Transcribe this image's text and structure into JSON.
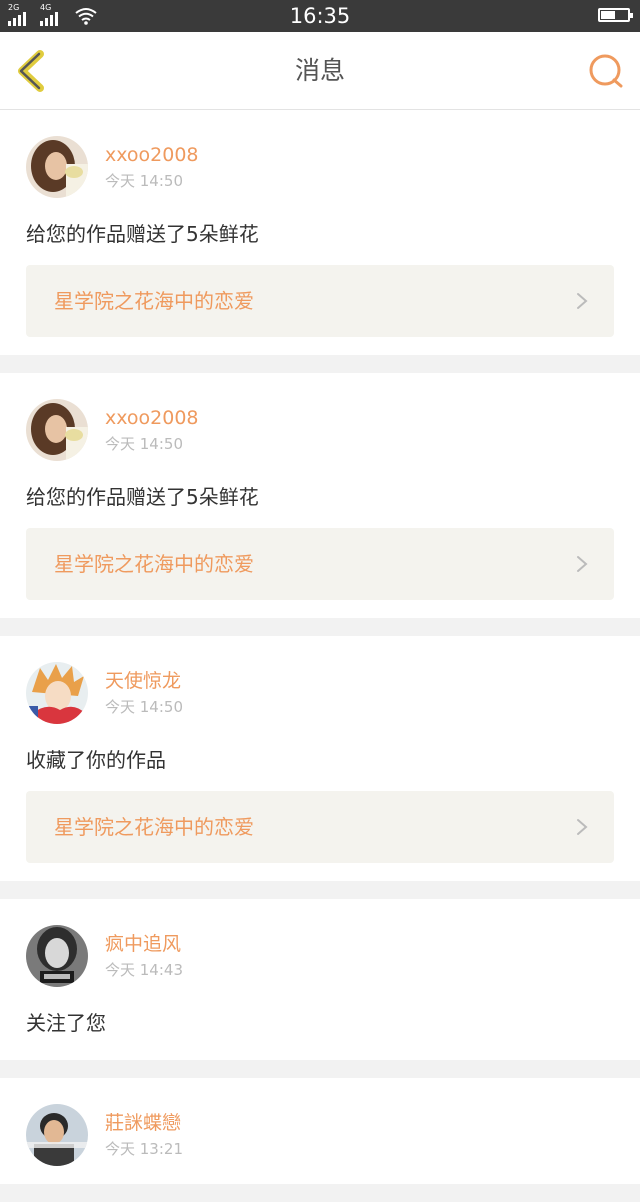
{
  "status_bar": {
    "network1": "2G",
    "network2": "4G",
    "time": "16:35",
    "battery_level": 0.55
  },
  "header": {
    "title": "消息",
    "back_icon": "chevron-left-icon",
    "search_icon": "search-icon",
    "accent_color": "#ef9a5e"
  },
  "messages": [
    {
      "username": "xxoo2008",
      "time": "今天 14:50",
      "action": "给您的作品赠送了5朵鲜花",
      "work_title": "星学院之花海中的恋爱",
      "avatar": "avatar-girl-icon"
    },
    {
      "username": "xxoo2008",
      "time": "今天 14:50",
      "action": "给您的作品赠送了5朵鲜花",
      "work_title": "星学院之花海中的恋爱",
      "avatar": "avatar-girl-icon"
    },
    {
      "username": "天使惊龙",
      "time": "今天 14:50",
      "action": "收藏了你的作品",
      "work_title": "星学院之花海中的恋爱",
      "avatar": "avatar-anime-icon"
    },
    {
      "username": "疯中追风",
      "time": "今天 14:43",
      "action": "关注了您",
      "avatar": "avatar-portrait-icon"
    },
    {
      "username": "莊詸蝶戀",
      "time": "今天 13:21",
      "avatar": "avatar-boy-icon"
    }
  ]
}
